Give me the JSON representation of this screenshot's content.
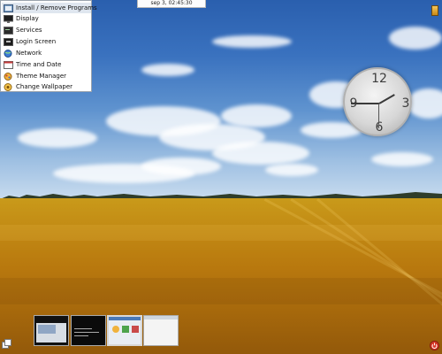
{
  "top_bar": {
    "datetime": "sep 3, 02:45:30"
  },
  "menu": {
    "items": [
      {
        "label": "Install / Remove Programs",
        "icon": "install-programs-icon",
        "selected": true
      },
      {
        "label": "Display",
        "icon": "monitor-icon",
        "selected": false
      },
      {
        "label": "Services",
        "icon": "services-icon",
        "selected": false
      },
      {
        "label": "Login Screen",
        "icon": "login-screen-icon",
        "selected": false
      },
      {
        "label": "Network",
        "icon": "network-globe-icon",
        "selected": false
      },
      {
        "label": "Time and Date",
        "icon": "calendar-icon",
        "selected": false
      },
      {
        "label": "Theme Manager",
        "icon": "theme-manager-icon",
        "selected": false
      },
      {
        "label": "Change Wallpaper",
        "icon": "wallpaper-icon",
        "selected": false
      }
    ]
  },
  "clock_widget": {
    "numerals": [
      "12",
      "3",
      "6",
      "9"
    ],
    "time": "02:45:30"
  },
  "taskbar": {
    "thumbnails": [
      "window-thumbnail-1",
      "window-thumbnail-2",
      "window-thumbnail-3",
      "window-thumbnail-4"
    ]
  },
  "colors": {
    "menu_selected": "#dfe6ef",
    "power_button": "#d83a2a"
  }
}
